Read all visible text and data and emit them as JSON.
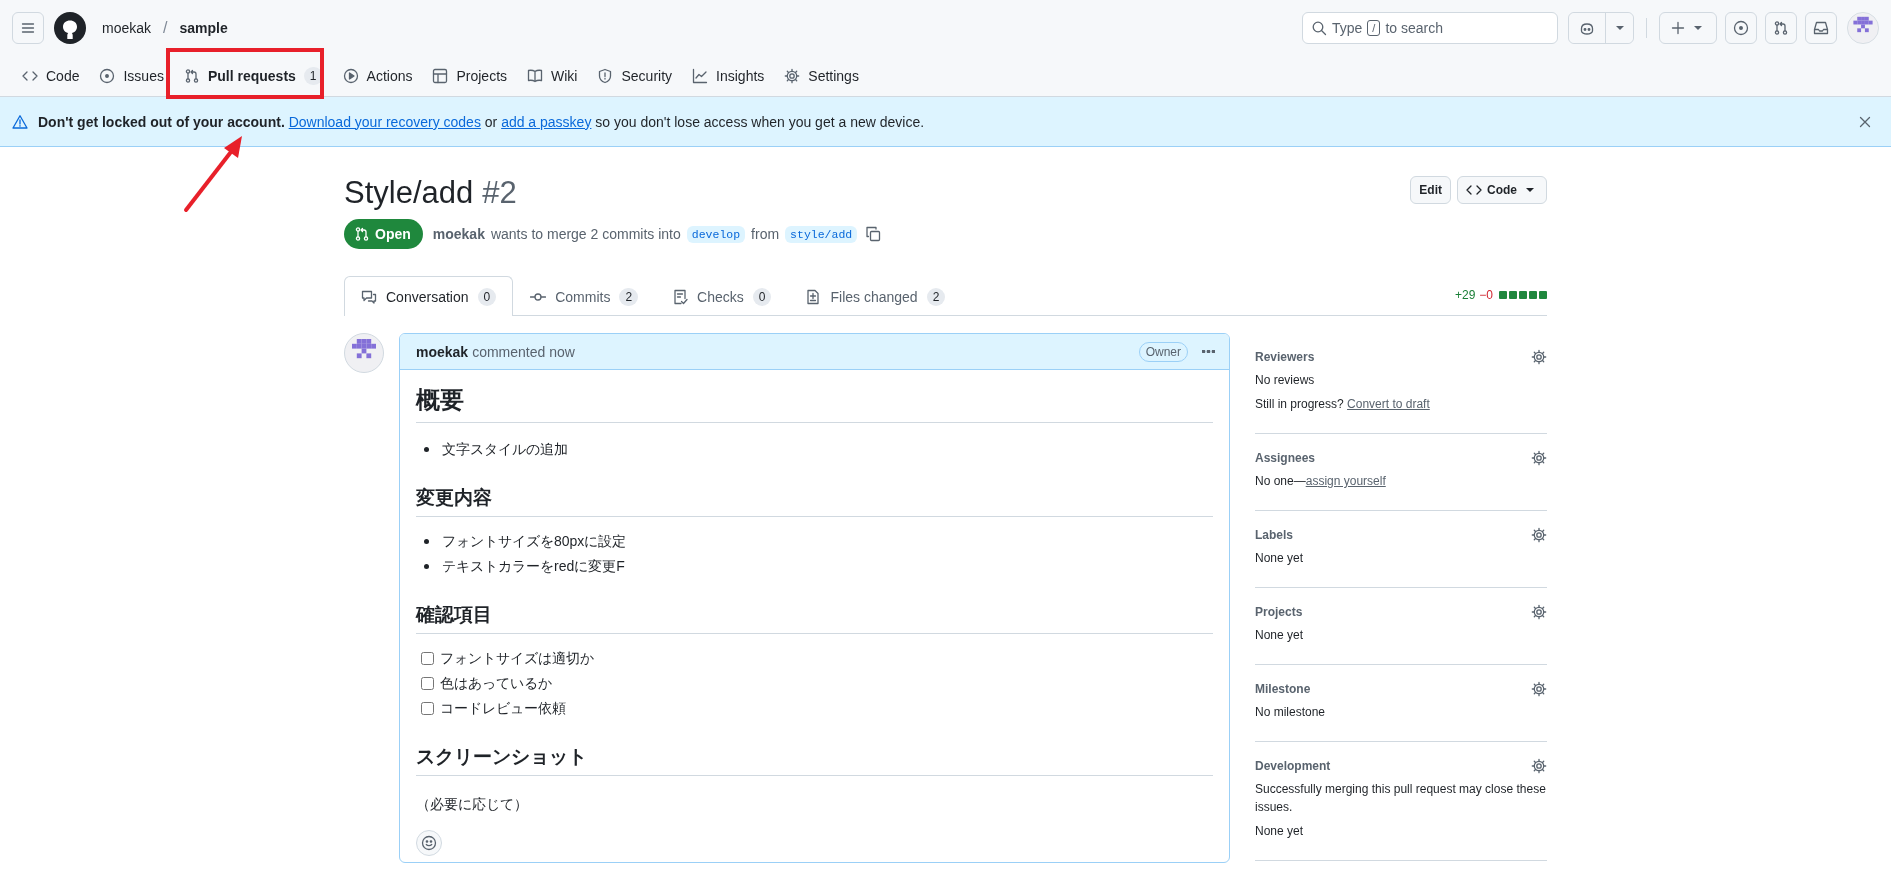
{
  "header": {
    "owner": "moekak",
    "separator": "/",
    "repo": "sample",
    "search": {
      "before": "Type",
      "key": "/",
      "after": "to search"
    }
  },
  "repo_tabs": [
    {
      "label": "Code",
      "selected": false
    },
    {
      "label": "Issues",
      "selected": false
    },
    {
      "label": "Pull requests",
      "counter": "1",
      "selected": true
    },
    {
      "label": "Actions",
      "selected": false
    },
    {
      "label": "Projects",
      "selected": false
    },
    {
      "label": "Wiki",
      "selected": false
    },
    {
      "label": "Security",
      "selected": false
    },
    {
      "label": "Insights",
      "selected": false
    },
    {
      "label": "Settings",
      "selected": false
    }
  ],
  "banner": {
    "lead": "**Don't get locked out of your account.**",
    "link_1": "Download your recovery codes",
    "middle": "or",
    "link_2": "add a passkey",
    "tail": "so you don't lose access when you get a new device."
  },
  "pull_request": {
    "title": "Style/add",
    "number": "#2",
    "state": {
      "label": "Open",
      "kind": "open"
    },
    "author": "moekak",
    "summary": "wants to merge 2 commits into",
    "base": "develop",
    "from": "from",
    "head": "style/add",
    "buttons": [
      "Edit",
      "Code"
    ]
  },
  "pr_tabs": [
    {
      "label": "Conversation",
      "counter": "0",
      "selected": true
    },
    {
      "label": "Commits",
      "counter": "2",
      "selected": false
    },
    {
      "label": "Checks",
      "counter": "0",
      "selected": false
    },
    {
      "label": "Files changed",
      "counter": "2",
      "selected": false
    }
  ],
  "diffstat": {
    "additions": "+29",
    "deletions": "−0"
  },
  "comment": {
    "author": "moekak",
    "action": "commented now",
    "badge": "Owner",
    "body": [
      {
        "kind": "h1",
        "text": "概要"
      },
      {
        "kind": "ul",
        "items": [
          "文字スタイルの追加"
        ]
      },
      {
        "kind": "h2",
        "text": "変更内容"
      },
      {
        "kind": "ul",
        "items": [
          "フォントサイズを80pxに設定",
          "テキストカラーをredに変更F"
        ]
      },
      {
        "kind": "h2",
        "text": "確認項目"
      },
      {
        "kind": "tasks",
        "items": [
          {
            "text": "フォントサイズは適切か",
            "checked": false
          },
          {
            "text": "色はあっているか",
            "checked": false
          },
          {
            "text": "コードレビュー依頼",
            "checked": false
          }
        ]
      },
      {
        "kind": "h2",
        "text": "スクリーンショット"
      },
      {
        "kind": "p",
        "text": "（必要に応じて）"
      }
    ]
  },
  "sidebar": [
    {
      "title": "Reviewers",
      "lines": [
        {
          "text": "No reviews"
        },
        {
          "text": "Still in progress? ",
          "link": "Convert to draft"
        }
      ]
    },
    {
      "title": "Assignees",
      "lines": [
        {
          "text": "No one—",
          "link": "assign yourself"
        }
      ]
    },
    {
      "title": "Labels",
      "lines": [
        {
          "text": "None yet"
        }
      ]
    },
    {
      "title": "Projects",
      "lines": [
        {
          "text": "None yet"
        }
      ]
    },
    {
      "title": "Milestone",
      "lines": [
        {
          "text": "No milestone"
        }
      ]
    },
    {
      "title": "Development",
      "lines": [
        {
          "text": "Successfully merging this pull request may close these issues."
        },
        {
          "text": "None yet"
        }
      ]
    }
  ]
}
